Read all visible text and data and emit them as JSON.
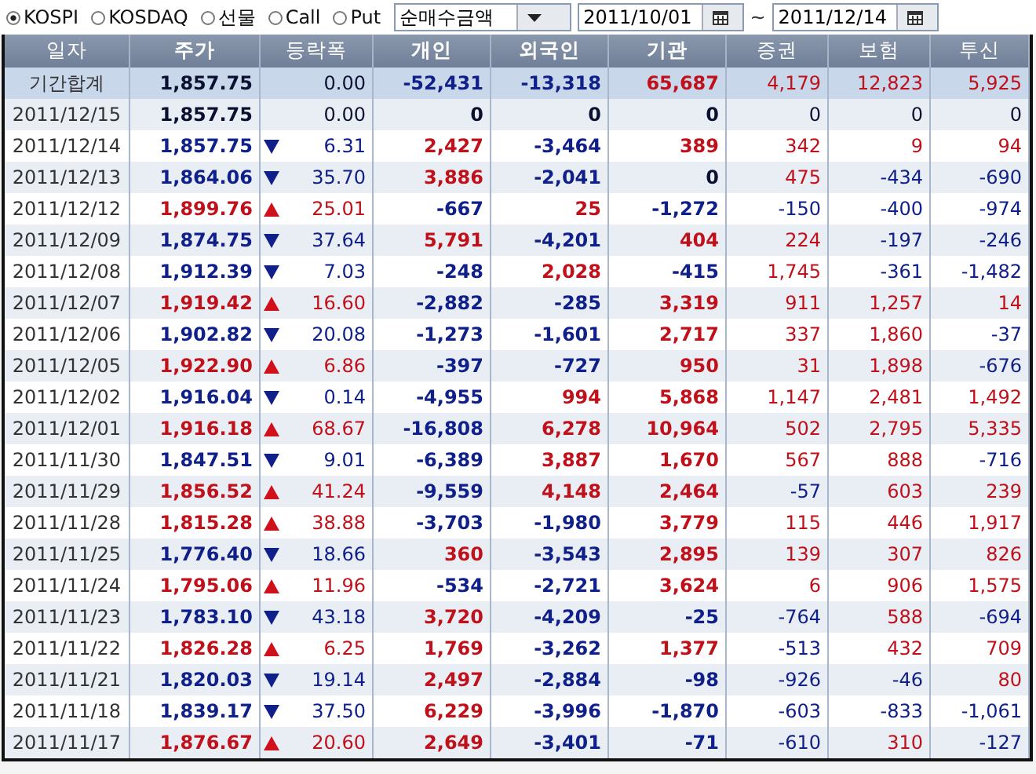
{
  "toolbar": {
    "markets": [
      {
        "label": "KOSPI",
        "selected": true
      },
      {
        "label": "KOSDAQ",
        "selected": false
      },
      {
        "label": "선물",
        "selected": false
      },
      {
        "label": "Call",
        "selected": false
      },
      {
        "label": "Put",
        "selected": false
      }
    ],
    "measure": "순매수금액",
    "date_from": "2011/10/01",
    "date_separator": "~",
    "date_to": "2011/12/14"
  },
  "table": {
    "columns": [
      "일자",
      "주가",
      "등락폭",
      "개인",
      "외국인",
      "기관",
      "증권",
      "보험",
      "투신"
    ],
    "rows": [
      {
        "kind": "summary",
        "cells": [
          {
            "text": "기간합계"
          },
          {
            "text": "1,857.75",
            "color": "#0a1030"
          },
          {
            "text": "0.00",
            "color": "#0a1030",
            "kind": "flat"
          },
          {
            "text": "-52,431",
            "color": "#10208a"
          },
          {
            "text": "-13,318",
            "color": "#10208a"
          },
          {
            "text": "65,687",
            "color": "#c0101a"
          },
          {
            "text": "4,179",
            "color": "#c0101a"
          },
          {
            "text": "12,823",
            "color": "#c0101a"
          },
          {
            "text": "5,925",
            "color": "#c0101a"
          }
        ]
      },
      {
        "kind": "day",
        "cells": [
          {
            "text": "2011/12/15"
          },
          {
            "text": "1,857.75",
            "color": "#0a1030"
          },
          {
            "text": "0.00",
            "color": "#0a1030",
            "kind": "flat"
          },
          {
            "text": "0",
            "color": "#0a1030"
          },
          {
            "text": "0",
            "color": "#0a1030"
          },
          {
            "text": "0",
            "color": "#0a1030"
          },
          {
            "text": "0",
            "color": "#0a1030"
          },
          {
            "text": "0",
            "color": "#0a1030"
          },
          {
            "text": "0",
            "color": "#0a1030"
          }
        ]
      },
      {
        "kind": "day",
        "cells": [
          {
            "text": "2011/12/14"
          },
          {
            "text": "1,857.75",
            "color": "#10208a"
          },
          {
            "text": "6.31",
            "color": "#10208a",
            "kind": "down"
          },
          {
            "text": "2,427",
            "color": "#c0101a"
          },
          {
            "text": "-3,464",
            "color": "#10208a"
          },
          {
            "text": "389",
            "color": "#c0101a"
          },
          {
            "text": "342",
            "color": "#c0101a"
          },
          {
            "text": "9",
            "color": "#c0101a"
          },
          {
            "text": "94",
            "color": "#c0101a"
          }
        ]
      },
      {
        "kind": "day",
        "cells": [
          {
            "text": "2011/12/13"
          },
          {
            "text": "1,864.06",
            "color": "#10208a"
          },
          {
            "text": "35.70",
            "color": "#10208a",
            "kind": "down"
          },
          {
            "text": "3,886",
            "color": "#c0101a"
          },
          {
            "text": "-2,041",
            "color": "#10208a"
          },
          {
            "text": "0",
            "color": "#0a1030"
          },
          {
            "text": "475",
            "color": "#c0101a"
          },
          {
            "text": "-434",
            "color": "#10208a"
          },
          {
            "text": "-690",
            "color": "#10208a"
          }
        ]
      },
      {
        "kind": "day",
        "cells": [
          {
            "text": "2011/12/12"
          },
          {
            "text": "1,899.76",
            "color": "#c0101a"
          },
          {
            "text": "25.01",
            "color": "#c0101a",
            "kind": "up"
          },
          {
            "text": "-667",
            "color": "#10208a"
          },
          {
            "text": "25",
            "color": "#c0101a"
          },
          {
            "text": "-1,272",
            "color": "#10208a"
          },
          {
            "text": "-150",
            "color": "#10208a"
          },
          {
            "text": "-400",
            "color": "#10208a"
          },
          {
            "text": "-974",
            "color": "#10208a"
          }
        ]
      },
      {
        "kind": "day",
        "cells": [
          {
            "text": "2011/12/09"
          },
          {
            "text": "1,874.75",
            "color": "#10208a"
          },
          {
            "text": "37.64",
            "color": "#10208a",
            "kind": "down"
          },
          {
            "text": "5,791",
            "color": "#c0101a"
          },
          {
            "text": "-4,201",
            "color": "#10208a"
          },
          {
            "text": "404",
            "color": "#c0101a"
          },
          {
            "text": "224",
            "color": "#c0101a"
          },
          {
            "text": "-197",
            "color": "#10208a"
          },
          {
            "text": "-246",
            "color": "#10208a"
          }
        ]
      },
      {
        "kind": "day",
        "cells": [
          {
            "text": "2011/12/08"
          },
          {
            "text": "1,912.39",
            "color": "#10208a"
          },
          {
            "text": "7.03",
            "color": "#10208a",
            "kind": "down"
          },
          {
            "text": "-248",
            "color": "#10208a"
          },
          {
            "text": "2,028",
            "color": "#c0101a"
          },
          {
            "text": "-415",
            "color": "#10208a"
          },
          {
            "text": "1,745",
            "color": "#c0101a"
          },
          {
            "text": "-361",
            "color": "#10208a"
          },
          {
            "text": "-1,482",
            "color": "#10208a"
          }
        ]
      },
      {
        "kind": "day",
        "cells": [
          {
            "text": "2011/12/07"
          },
          {
            "text": "1,919.42",
            "color": "#c0101a"
          },
          {
            "text": "16.60",
            "color": "#c0101a",
            "kind": "up"
          },
          {
            "text": "-2,882",
            "color": "#10208a"
          },
          {
            "text": "-285",
            "color": "#10208a"
          },
          {
            "text": "3,319",
            "color": "#c0101a"
          },
          {
            "text": "911",
            "color": "#c0101a"
          },
          {
            "text": "1,257",
            "color": "#c0101a"
          },
          {
            "text": "14",
            "color": "#c0101a"
          }
        ]
      },
      {
        "kind": "day",
        "cells": [
          {
            "text": "2011/12/06"
          },
          {
            "text": "1,902.82",
            "color": "#10208a"
          },
          {
            "text": "20.08",
            "color": "#10208a",
            "kind": "down"
          },
          {
            "text": "-1,273",
            "color": "#10208a"
          },
          {
            "text": "-1,601",
            "color": "#10208a"
          },
          {
            "text": "2,717",
            "color": "#c0101a"
          },
          {
            "text": "337",
            "color": "#c0101a"
          },
          {
            "text": "1,860",
            "color": "#c0101a"
          },
          {
            "text": "-37",
            "color": "#10208a"
          }
        ]
      },
      {
        "kind": "day",
        "cells": [
          {
            "text": "2011/12/05"
          },
          {
            "text": "1,922.90",
            "color": "#c0101a"
          },
          {
            "text": "6.86",
            "color": "#c0101a",
            "kind": "up"
          },
          {
            "text": "-397",
            "color": "#10208a"
          },
          {
            "text": "-727",
            "color": "#10208a"
          },
          {
            "text": "950",
            "color": "#c0101a"
          },
          {
            "text": "31",
            "color": "#c0101a"
          },
          {
            "text": "1,898",
            "color": "#c0101a"
          },
          {
            "text": "-676",
            "color": "#10208a"
          }
        ]
      },
      {
        "kind": "day",
        "cells": [
          {
            "text": "2011/12/02"
          },
          {
            "text": "1,916.04",
            "color": "#10208a"
          },
          {
            "text": "0.14",
            "color": "#10208a",
            "kind": "down"
          },
          {
            "text": "-4,955",
            "color": "#10208a"
          },
          {
            "text": "994",
            "color": "#c0101a"
          },
          {
            "text": "5,868",
            "color": "#c0101a"
          },
          {
            "text": "1,147",
            "color": "#c0101a"
          },
          {
            "text": "2,481",
            "color": "#c0101a"
          },
          {
            "text": "1,492",
            "color": "#c0101a"
          }
        ]
      },
      {
        "kind": "day",
        "cells": [
          {
            "text": "2011/12/01"
          },
          {
            "text": "1,916.18",
            "color": "#c0101a"
          },
          {
            "text": "68.67",
            "color": "#c0101a",
            "kind": "up"
          },
          {
            "text": "-16,808",
            "color": "#10208a"
          },
          {
            "text": "6,278",
            "color": "#c0101a"
          },
          {
            "text": "10,964",
            "color": "#c0101a"
          },
          {
            "text": "502",
            "color": "#c0101a"
          },
          {
            "text": "2,795",
            "color": "#c0101a"
          },
          {
            "text": "5,335",
            "color": "#c0101a"
          }
        ]
      },
      {
        "kind": "day",
        "cells": [
          {
            "text": "2011/11/30"
          },
          {
            "text": "1,847.51",
            "color": "#10208a"
          },
          {
            "text": "9.01",
            "color": "#10208a",
            "kind": "down"
          },
          {
            "text": "-6,389",
            "color": "#10208a"
          },
          {
            "text": "3,887",
            "color": "#c0101a"
          },
          {
            "text": "1,670",
            "color": "#c0101a"
          },
          {
            "text": "567",
            "color": "#c0101a"
          },
          {
            "text": "888",
            "color": "#c0101a"
          },
          {
            "text": "-716",
            "color": "#10208a"
          }
        ]
      },
      {
        "kind": "day",
        "cells": [
          {
            "text": "2011/11/29"
          },
          {
            "text": "1,856.52",
            "color": "#c0101a"
          },
          {
            "text": "41.24",
            "color": "#c0101a",
            "kind": "up"
          },
          {
            "text": "-9,559",
            "color": "#10208a"
          },
          {
            "text": "4,148",
            "color": "#c0101a"
          },
          {
            "text": "2,464",
            "color": "#c0101a"
          },
          {
            "text": "-57",
            "color": "#10208a"
          },
          {
            "text": "603",
            "color": "#c0101a"
          },
          {
            "text": "239",
            "color": "#c0101a"
          }
        ]
      },
      {
        "kind": "day",
        "cells": [
          {
            "text": "2011/11/28"
          },
          {
            "text": "1,815.28",
            "color": "#c0101a"
          },
          {
            "text": "38.88",
            "color": "#c0101a",
            "kind": "up"
          },
          {
            "text": "-3,703",
            "color": "#10208a"
          },
          {
            "text": "-1,980",
            "color": "#10208a"
          },
          {
            "text": "3,779",
            "color": "#c0101a"
          },
          {
            "text": "115",
            "color": "#c0101a"
          },
          {
            "text": "446",
            "color": "#c0101a"
          },
          {
            "text": "1,917",
            "color": "#c0101a"
          }
        ]
      },
      {
        "kind": "day",
        "cells": [
          {
            "text": "2011/11/25"
          },
          {
            "text": "1,776.40",
            "color": "#10208a"
          },
          {
            "text": "18.66",
            "color": "#10208a",
            "kind": "down"
          },
          {
            "text": "360",
            "color": "#c0101a"
          },
          {
            "text": "-3,543",
            "color": "#10208a"
          },
          {
            "text": "2,895",
            "color": "#c0101a"
          },
          {
            "text": "139",
            "color": "#c0101a"
          },
          {
            "text": "307",
            "color": "#c0101a"
          },
          {
            "text": "826",
            "color": "#c0101a"
          }
        ]
      },
      {
        "kind": "day",
        "cells": [
          {
            "text": "2011/11/24"
          },
          {
            "text": "1,795.06",
            "color": "#c0101a"
          },
          {
            "text": "11.96",
            "color": "#c0101a",
            "kind": "up"
          },
          {
            "text": "-534",
            "color": "#10208a"
          },
          {
            "text": "-2,721",
            "color": "#10208a"
          },
          {
            "text": "3,624",
            "color": "#c0101a"
          },
          {
            "text": "6",
            "color": "#c0101a"
          },
          {
            "text": "906",
            "color": "#c0101a"
          },
          {
            "text": "1,575",
            "color": "#c0101a"
          }
        ]
      },
      {
        "kind": "day",
        "cells": [
          {
            "text": "2011/11/23"
          },
          {
            "text": "1,783.10",
            "color": "#10208a"
          },
          {
            "text": "43.18",
            "color": "#10208a",
            "kind": "down"
          },
          {
            "text": "3,720",
            "color": "#c0101a"
          },
          {
            "text": "-4,209",
            "color": "#10208a"
          },
          {
            "text": "-25",
            "color": "#10208a"
          },
          {
            "text": "-764",
            "color": "#10208a"
          },
          {
            "text": "588",
            "color": "#c0101a"
          },
          {
            "text": "-694",
            "color": "#10208a"
          }
        ]
      },
      {
        "kind": "day",
        "cells": [
          {
            "text": "2011/11/22"
          },
          {
            "text": "1,826.28",
            "color": "#c0101a"
          },
          {
            "text": "6.25",
            "color": "#c0101a",
            "kind": "up"
          },
          {
            "text": "1,769",
            "color": "#c0101a"
          },
          {
            "text": "-3,262",
            "color": "#10208a"
          },
          {
            "text": "1,377",
            "color": "#c0101a"
          },
          {
            "text": "-513",
            "color": "#10208a"
          },
          {
            "text": "432",
            "color": "#c0101a"
          },
          {
            "text": "709",
            "color": "#c0101a"
          }
        ]
      },
      {
        "kind": "day",
        "cells": [
          {
            "text": "2011/11/21"
          },
          {
            "text": "1,820.03",
            "color": "#10208a"
          },
          {
            "text": "19.14",
            "color": "#10208a",
            "kind": "down"
          },
          {
            "text": "2,497",
            "color": "#c0101a"
          },
          {
            "text": "-2,884",
            "color": "#10208a"
          },
          {
            "text": "-98",
            "color": "#10208a"
          },
          {
            "text": "-926",
            "color": "#10208a"
          },
          {
            "text": "-46",
            "color": "#10208a"
          },
          {
            "text": "80",
            "color": "#c0101a"
          }
        ]
      },
      {
        "kind": "day",
        "cells": [
          {
            "text": "2011/11/18"
          },
          {
            "text": "1,839.17",
            "color": "#10208a"
          },
          {
            "text": "37.50",
            "color": "#10208a",
            "kind": "down"
          },
          {
            "text": "6,229",
            "color": "#c0101a"
          },
          {
            "text": "-3,996",
            "color": "#10208a"
          },
          {
            "text": "-1,870",
            "color": "#10208a"
          },
          {
            "text": "-603",
            "color": "#10208a"
          },
          {
            "text": "-833",
            "color": "#10208a"
          },
          {
            "text": "-1,061",
            "color": "#10208a"
          }
        ]
      },
      {
        "kind": "day",
        "cells": [
          {
            "text": "2011/11/17"
          },
          {
            "text": "1,876.67",
            "color": "#c0101a"
          },
          {
            "text": "20.60",
            "color": "#c0101a",
            "kind": "up"
          },
          {
            "text": "2,649",
            "color": "#c0101a"
          },
          {
            "text": "-3,401",
            "color": "#10208a"
          },
          {
            "text": "-71",
            "color": "#10208a"
          },
          {
            "text": "-610",
            "color": "#10208a"
          },
          {
            "text": "310",
            "color": "#c0101a"
          },
          {
            "text": "-127",
            "color": "#10208a"
          }
        ]
      }
    ]
  }
}
